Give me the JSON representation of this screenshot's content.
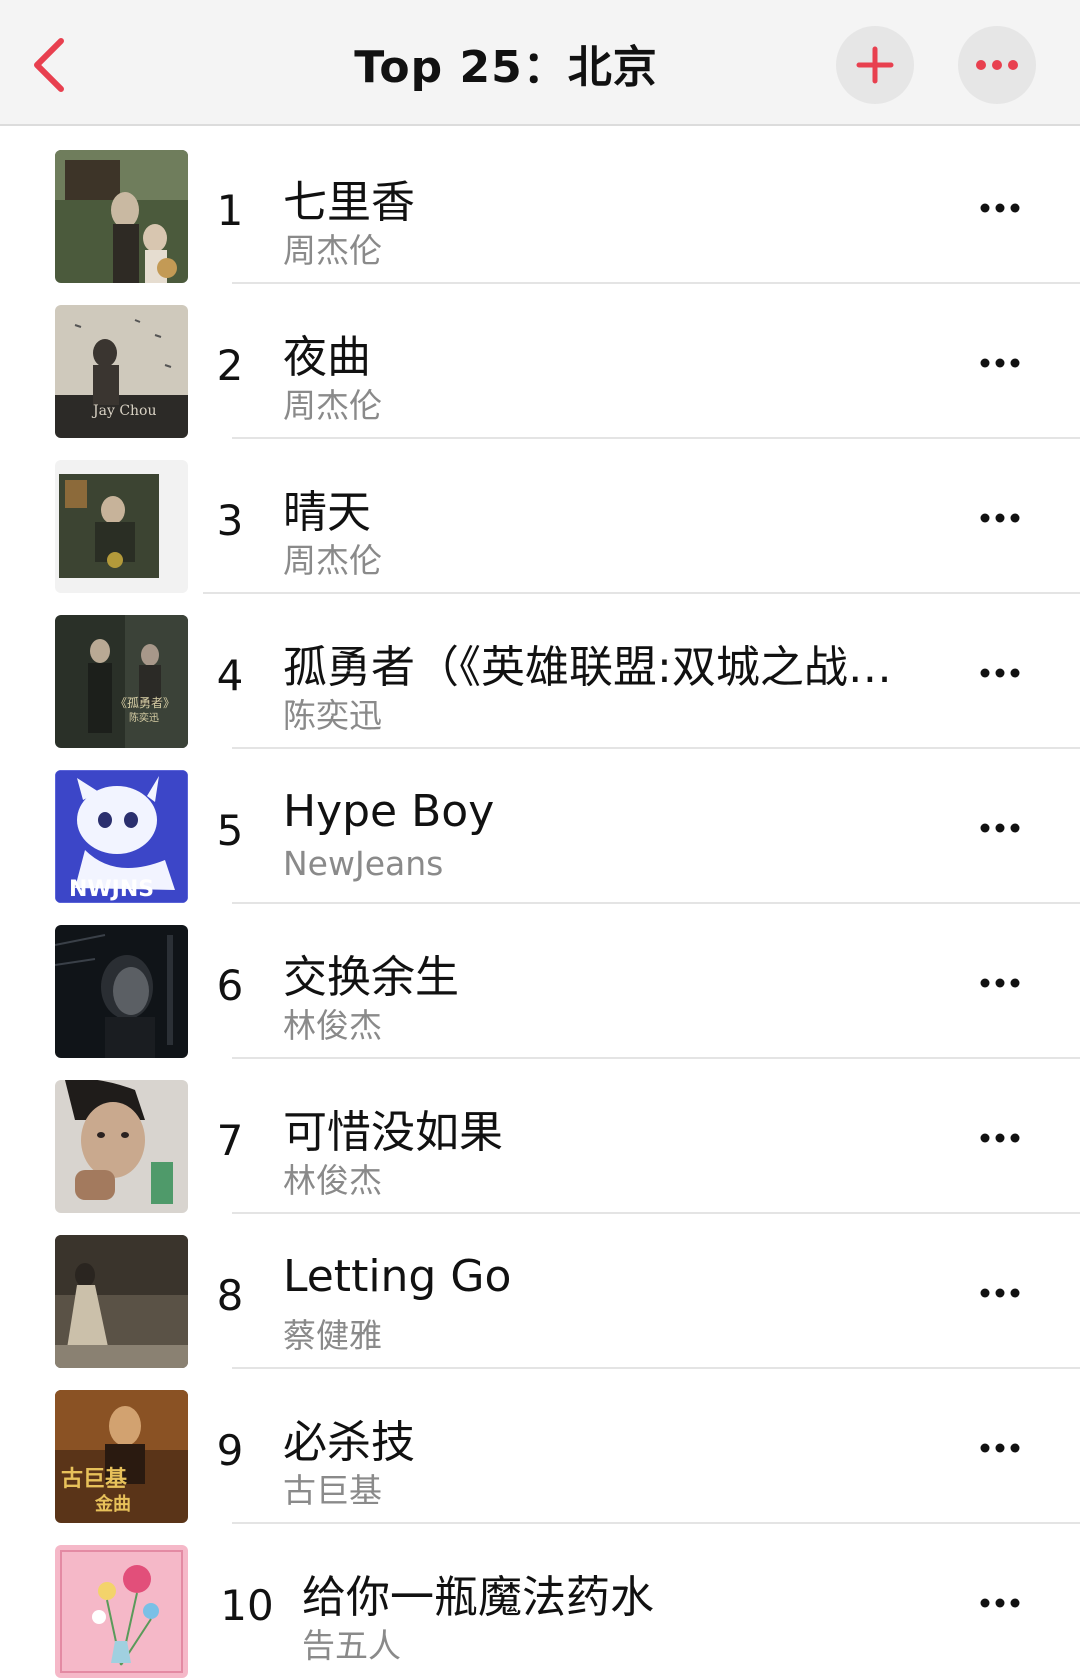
{
  "header": {
    "title": "Top 25：北京",
    "accent_color": "#e8404f",
    "back_icon": "chevron-left-icon",
    "add_icon": "plus-icon",
    "more_icon": "ellipsis-icon"
  },
  "tracks": [
    {
      "rank": "1",
      "title": "七里香",
      "artist": "周杰伦",
      "art_color": "#4b5a3c"
    },
    {
      "rank": "2",
      "title": "夜曲",
      "artist": "周杰伦",
      "art_color": "#cfc9bc"
    },
    {
      "rank": "3",
      "title": "晴天",
      "artist": "周杰伦",
      "art_color": "#3c4432"
    },
    {
      "rank": "4",
      "title": "孤勇者（《英雄联盟:双城之战》动画剧集中文主题曲）",
      "artist": "陈奕迅",
      "art_color": "#2a3028"
    },
    {
      "rank": "5",
      "title": "Hype Boy",
      "artist": "NewJeans",
      "art_color": "#3c46c8"
    },
    {
      "rank": "6",
      "title": "交换余生",
      "artist": "林俊杰",
      "art_color": "#101418"
    },
    {
      "rank": "7",
      "title": "可惜没如果",
      "artist": "林俊杰",
      "art_color": "#d8d4cf"
    },
    {
      "rank": "8",
      "title": "Letting Go",
      "artist": "蔡健雅",
      "art_color": "#5a5246"
    },
    {
      "rank": "9",
      "title": "必杀技",
      "artist": "古巨基",
      "art_color": "#5a3418"
    },
    {
      "rank": "10",
      "title": "给你一瓶魔法药水",
      "artist": "告五人",
      "art_color": "#f5b8c8"
    }
  ]
}
